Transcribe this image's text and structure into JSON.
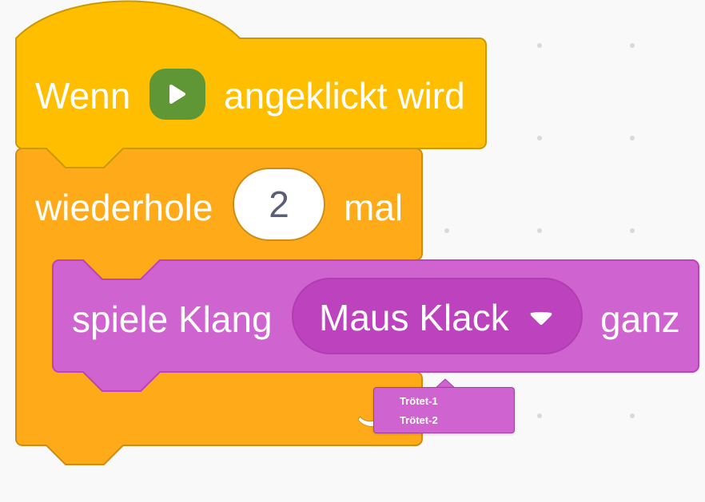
{
  "event_block": {
    "label_before": "Wenn",
    "flag_icon": "green-flag-icon",
    "label_after": "angeklickt wird",
    "color": "#ffbf00"
  },
  "repeat_block": {
    "label_before": "wiederhole",
    "count": "2",
    "label_after": "mal",
    "color": "#ffab19"
  },
  "sound_block": {
    "label_before": "spiele Klang",
    "selected_sound": "Maus Klack",
    "label_after": "ganz",
    "color": "#cf63cf"
  },
  "dropdown_menu": {
    "items": [
      "Trötet-1",
      "Trötet-2"
    ]
  }
}
